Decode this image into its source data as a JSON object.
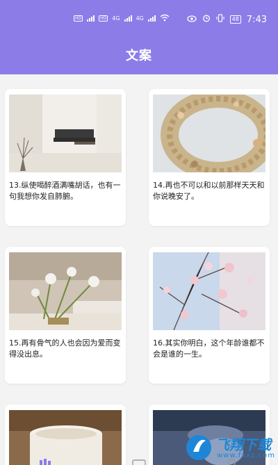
{
  "status_bar": {
    "left_badges": [
      "HD",
      "HD"
    ],
    "network_labels": [
      "4G",
      "4G"
    ],
    "battery": "48",
    "time": "7:43"
  },
  "header": {
    "title": "文案"
  },
  "cards": [
    {
      "caption": "13.纵使喝醉酒满嘴胡话，也有一句我想你发自肺腑。"
    },
    {
      "caption": "14.再也不可以和以前那样天天和你说晚安了。"
    },
    {
      "caption": "15.再有骨气的人也会因为爱而变得没出息。"
    },
    {
      "caption": "16.其实你明白，这个年龄谁都不会是谁的一生。"
    },
    {
      "caption": ""
    },
    {
      "caption": ""
    }
  ],
  "watermark": {
    "brand": "飞翔下载",
    "url": "www.fxxz.com"
  },
  "colors": {
    "header_bg": "#8c7ce8",
    "page_bg": "#f3f3f3",
    "nav_active": "#8c7ce8"
  }
}
